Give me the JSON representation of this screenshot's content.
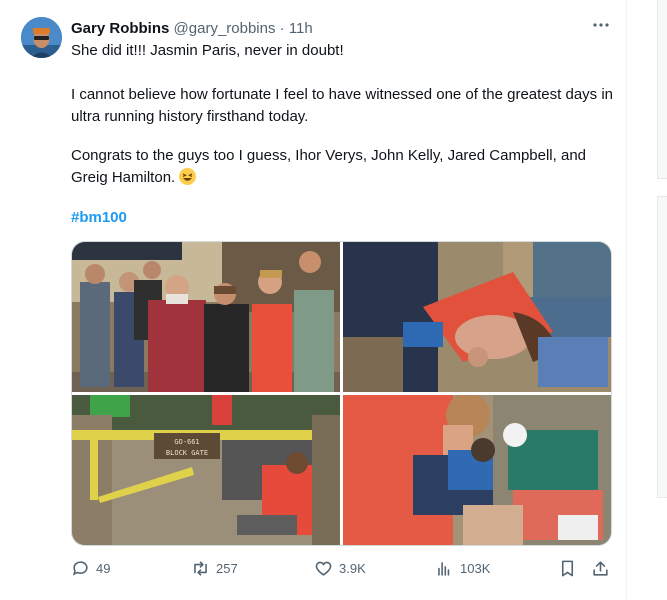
{
  "tweet": {
    "author_name": "Gary Robbins",
    "author_handle": "@gary_robbins",
    "separator": "·",
    "time": "11h",
    "more_icon": "more-horizontal-icon",
    "line1": "She did it!!! Jasmin Paris, never in doubt!",
    "line2": "I cannot believe how fortunate I feel to have witnessed one of the greatest days in ultra running history firsthand today.",
    "line3": "Congrats to the guys too I guess, Ihor Verys, John Kelly, Jared Campbell, and Greig Hamilton.",
    "emoji": "grinning-squinting-face",
    "hashtag": "#bm100",
    "gate_sign_line1": "GO-661",
    "gate_sign_line2": "BLOCK GATE"
  },
  "actions": {
    "replies": "49",
    "reposts": "257",
    "likes": "3.9K",
    "views": "103K"
  },
  "colors": {
    "accent": "#1d9bf0",
    "muted": "#536471",
    "text": "#0f1419"
  }
}
